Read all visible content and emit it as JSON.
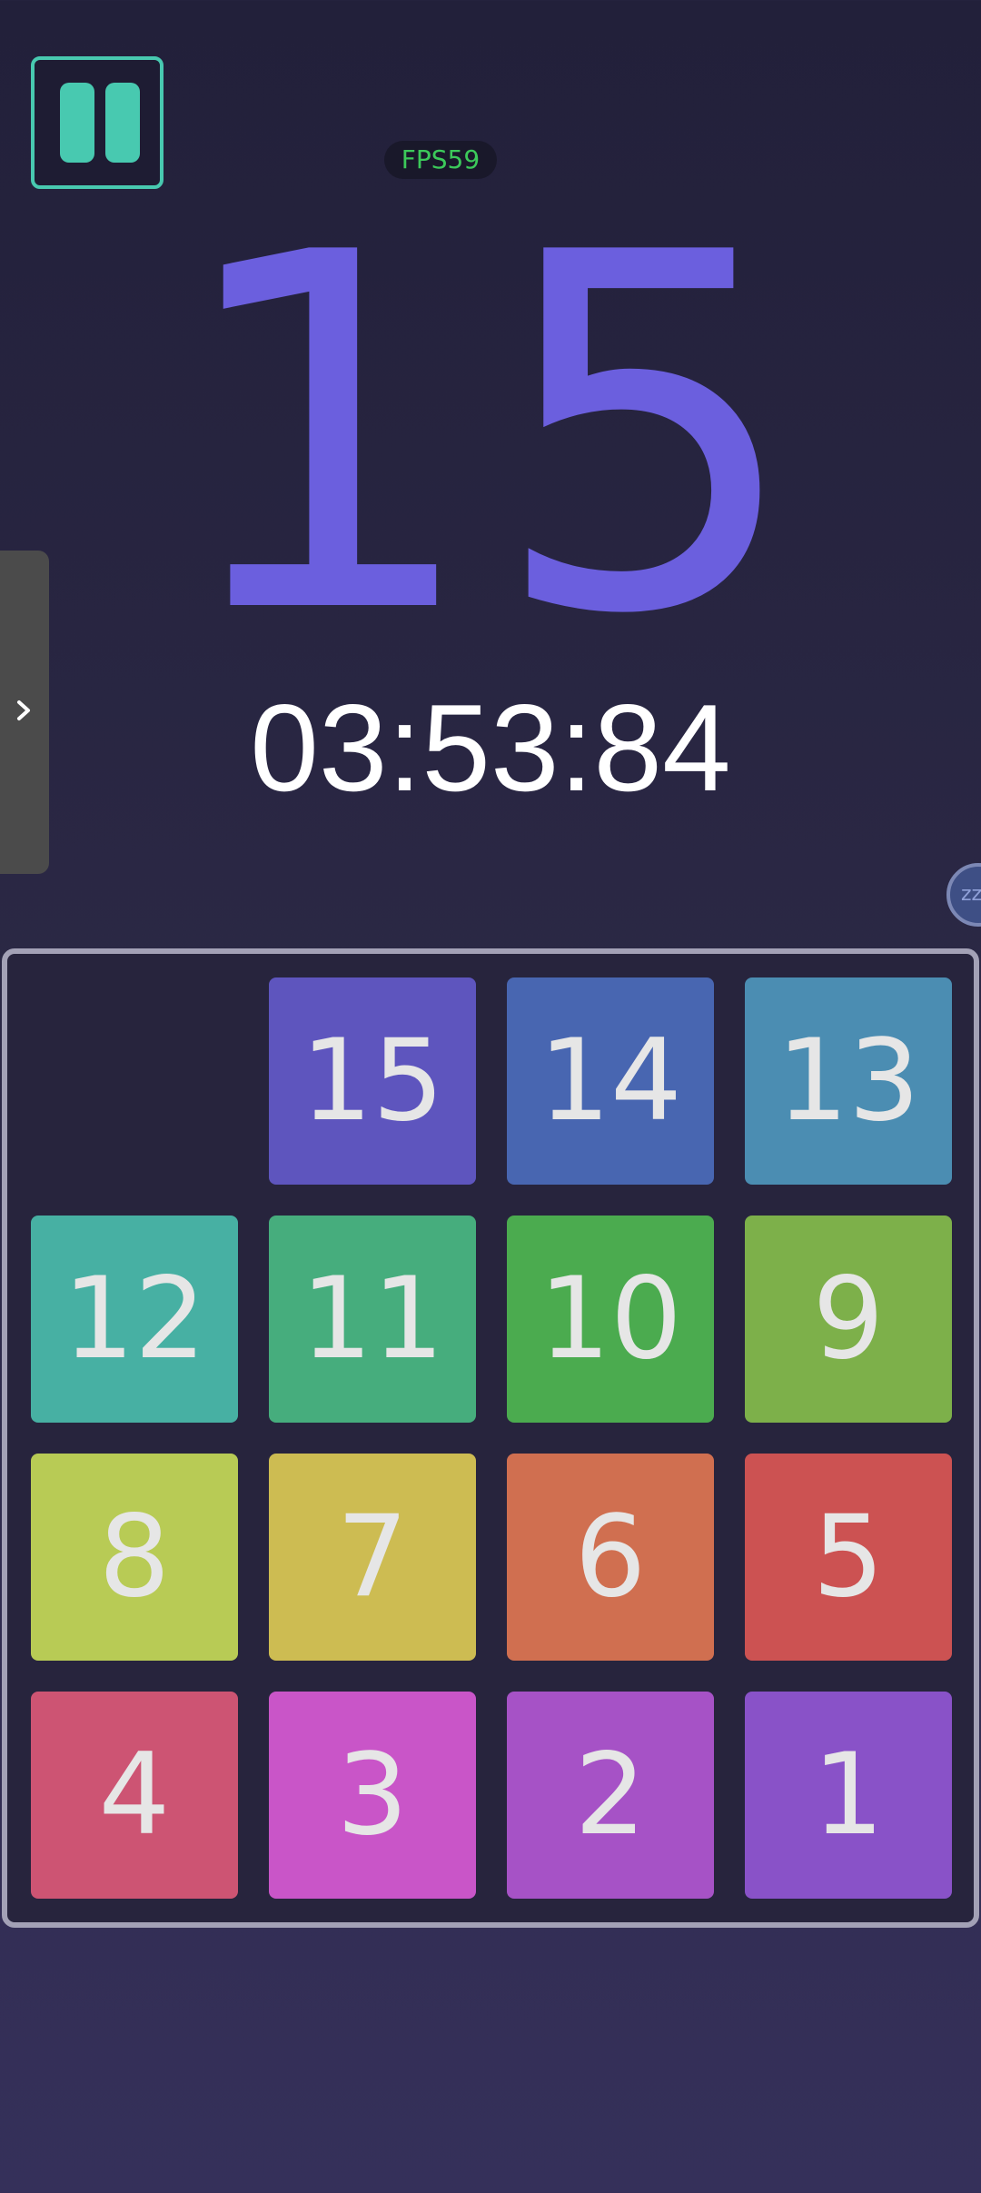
{
  "hud": {
    "fps_label": "FPS59",
    "moves": "15",
    "timer": "03:53:84"
  },
  "icons": {
    "pause": "pause-icon",
    "drawer": "chevron-right-icon",
    "bubble": "floating-bubble-icon"
  },
  "floating_bubble_text": "zz",
  "colors": {
    "accent": "#48c9b0",
    "moves_text": "#6b5fde",
    "fps_text": "#3cc95a"
  },
  "board": {
    "rows": 4,
    "cols": 4,
    "empty_cell": {
      "row": 0,
      "col": 0
    },
    "tiles": [
      {
        "row": 0,
        "col": 1,
        "label": "15",
        "color": "#5e55be"
      },
      {
        "row": 0,
        "col": 2,
        "label": "14",
        "color": "#4866b1"
      },
      {
        "row": 0,
        "col": 3,
        "label": "13",
        "color": "#4b8db2"
      },
      {
        "row": 1,
        "col": 0,
        "label": "12",
        "color": "#47b0a3"
      },
      {
        "row": 1,
        "col": 1,
        "label": "11",
        "color": "#46ad7d"
      },
      {
        "row": 1,
        "col": 2,
        "label": "10",
        "color": "#4bab4f"
      },
      {
        "row": 1,
        "col": 3,
        "label": "9",
        "color": "#7db04a"
      },
      {
        "row": 2,
        "col": 0,
        "label": "8",
        "color": "#b8cb55"
      },
      {
        "row": 2,
        "col": 1,
        "label": "7",
        "color": "#cdbc52"
      },
      {
        "row": 2,
        "col": 2,
        "label": "6",
        "color": "#d06f50"
      },
      {
        "row": 2,
        "col": 3,
        "label": "5",
        "color": "#cc5252"
      },
      {
        "row": 3,
        "col": 0,
        "label": "4",
        "color": "#cd5473"
      },
      {
        "row": 3,
        "col": 1,
        "label": "3",
        "color": "#c955c8"
      },
      {
        "row": 3,
        "col": 2,
        "label": "2",
        "color": "#a652c6"
      },
      {
        "row": 3,
        "col": 3,
        "label": "1",
        "color": "#8952c8"
      }
    ]
  }
}
